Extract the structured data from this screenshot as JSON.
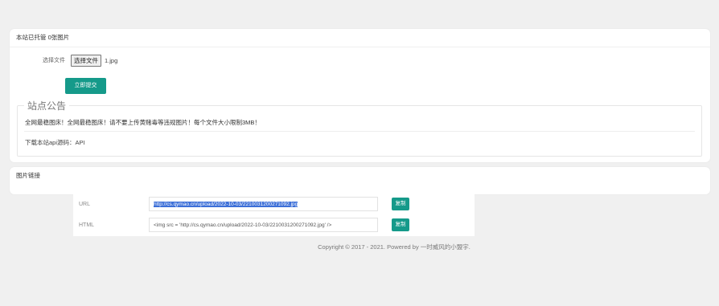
{
  "topbar": {
    "faint_text": ""
  },
  "upload_card": {
    "header": "本站已托管 0张图片",
    "file_label": "选择文件",
    "file_button": "选择文件",
    "file_name": "1.jpg",
    "submit_label": "立即提交"
  },
  "notice": {
    "title": "站点公告",
    "line1": "全网最稳图床！全网最稳图床！请不要上传黄赌毒等违规图片！每个文件大小限制3MB！",
    "line2": "下载本站api源码：API"
  },
  "links_card": {
    "header": "图片链接",
    "rows": [
      {
        "label": "URL",
        "value": "http://cs.qymao.cn/upload/2022-10-03/2210031200271092.jpg",
        "copy": "复制"
      },
      {
        "label": "HTML",
        "value": "<img src = 'http://cs.qymao.cn/upload/2022-10-03/2210031200271092.jpg' />",
        "copy": "复制"
      }
    ]
  },
  "footer": {
    "copyright": "Copyright © 2017 - 2021. Powered by 一时威风的小盟宇."
  },
  "colors": {
    "accent": "#159a8a",
    "selection": "#3c6fd8",
    "background": "#f0f0f0"
  }
}
